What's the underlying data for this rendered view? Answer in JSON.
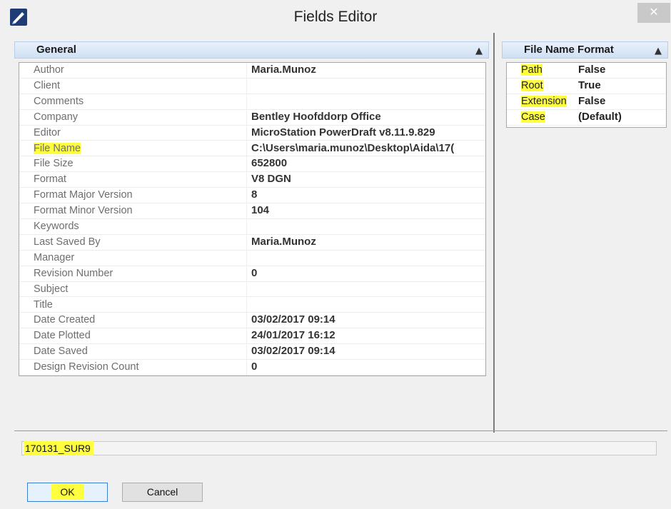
{
  "window": {
    "title": "Fields Editor",
    "close_label": "✕"
  },
  "general": {
    "header": "General",
    "rows": [
      {
        "name": "Author",
        "value": "Maria.Munoz"
      },
      {
        "name": "Client",
        "value": ""
      },
      {
        "name": "Comments",
        "value": ""
      },
      {
        "name": "Company",
        "value": "Bentley Hoofddorp Office"
      },
      {
        "name": "Editor",
        "value": "MicroStation PowerDraft v8.11.9.829"
      },
      {
        "name": "File Name",
        "value": "C:\\Users\\maria.munoz\\Desktop\\Aida\\17("
      },
      {
        "name": "File Size",
        "value": "652800"
      },
      {
        "name": "Format",
        "value": "V8 DGN"
      },
      {
        "name": "Format Major Version",
        "value": "8"
      },
      {
        "name": "Format Minor Version",
        "value": "104"
      },
      {
        "name": "Keywords",
        "value": ""
      },
      {
        "name": "Last Saved By",
        "value": "Maria.Munoz"
      },
      {
        "name": "Manager",
        "value": ""
      },
      {
        "name": "Revision Number",
        "value": "0"
      },
      {
        "name": "Subject",
        "value": ""
      },
      {
        "name": "Title",
        "value": ""
      },
      {
        "name": "Date Created",
        "value": "03/02/2017 09:14"
      },
      {
        "name": "Date Plotted",
        "value": "24/01/2017 16:12"
      },
      {
        "name": "Date Saved",
        "value": "03/02/2017 09:14"
      },
      {
        "name": "Design Revision Count",
        "value": "0"
      }
    ]
  },
  "file_name_format": {
    "header": "File Name Format",
    "rows": [
      {
        "name": "Path",
        "value": "False"
      },
      {
        "name": "Root",
        "value": "True"
      },
      {
        "name": "Extension",
        "value": "False"
      },
      {
        "name": "Case",
        "value": "(Default)"
      }
    ]
  },
  "result": {
    "value": "170131_SUR9"
  },
  "buttons": {
    "ok": "OK",
    "cancel": "Cancel"
  },
  "icons": {
    "app": "microstation-app-icon",
    "caret": "chevron-up-icon"
  },
  "colors": {
    "highlight": "#ffff40",
    "header_gradient_top": "#e9f1fb",
    "header_gradient_bottom": "#cfe0f5"
  }
}
